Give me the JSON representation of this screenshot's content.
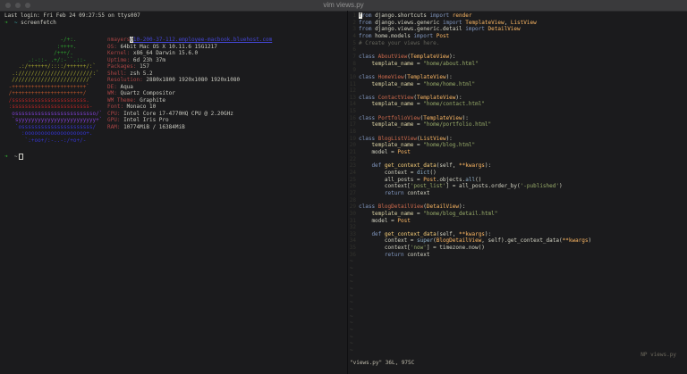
{
  "window": {
    "title": "vim views.py"
  },
  "terminal": {
    "last_login": "Last login: Fri Feb 24 09:27:55 on ttys007",
    "prompt_symbol": "➜",
    "prompt_path": "~",
    "command": "screenfetch",
    "host_line": {
      "user": "nmayers",
      "at": "@",
      "host": "10-200-37-112.employee-macbook.bluehost.com"
    },
    "ascii_art": [
      {
        "t": "                 -/+:.",
        "c": "green"
      },
      {
        "t": "                :++++.",
        "c": "green"
      },
      {
        "t": "               /+++/.",
        "c": "green"
      },
      {
        "t": "       .:-::- .+/:-``.::-",
        "c": "green"
      },
      {
        "t": "    .:/++++++/::::/++++++/:`",
        "c": "yellow"
      },
      {
        "t": "  .:///////////////////////:`",
        "c": "yellow"
      },
      {
        "t": "  ////////////////////////`",
        "c": "yellow"
      },
      {
        "t": " -+++++++++++++++++++++++`",
        "c": "orange"
      },
      {
        "t": " /++++++++++++++++++++++/",
        "c": "orange"
      },
      {
        "t": " /sssssssssssssssssssssss.",
        "c": "red"
      },
      {
        "t": " :ssssssssssssssssssssssss-",
        "c": "red"
      },
      {
        "t": "  osssssssssssssssssssssssso/`",
        "c": "purple"
      },
      {
        "t": "  `syyyyyyyyyyyyyyyyyyyyyyyy+`",
        "c": "purple"
      },
      {
        "t": "   `ossssssssssssssssssssss/",
        "c": "blue"
      },
      {
        "t": "     :ooooooooooooooooooo+.",
        "c": "blue"
      },
      {
        "t": "      `:+oo+/:-..-:/+o+/-",
        "c": "blue"
      }
    ],
    "info": [
      {
        "label": "OS:",
        "value": " 64bit Mac OS X 10.11.6 15G1217"
      },
      {
        "label": "Kernel:",
        "value": " x86_64 Darwin 15.6.0"
      },
      {
        "label": "Uptime:",
        "value": " 6d 23h 37m"
      },
      {
        "label": "Packages:",
        "value": " 157"
      },
      {
        "label": "Shell:",
        "value": " zsh 5.2"
      },
      {
        "label": "Resolution:",
        "value": " 2880x1800 1920x1080 1920x1080"
      },
      {
        "label": "DE:",
        "value": " Aqua"
      },
      {
        "label": "WM:",
        "value": " Quartz Compositor"
      },
      {
        "label": "WM Theme:",
        "value": " Graphite"
      },
      {
        "label": "Font:",
        "value": " Monaco 10"
      },
      {
        "label": "CPU:",
        "value": " Intel Core i7-4770HQ CPU @ 2.20GHz"
      },
      {
        "label": "GPU:",
        "value": " Intel Iris Pro"
      },
      {
        "label": "RAM:",
        "value": " 10774MiB / 16384MiB"
      }
    ],
    "colors": {
      "text": "#c9c9c0",
      "label": "#a84444",
      "host": "#4446d4",
      "green": "#2e9e2e",
      "yellow": "#a3a32e",
      "orange": "#b8552a",
      "red": "#b22424",
      "purple": "#7d3fd0",
      "blue": "#3434cf",
      "cyan": "#3fb3b3"
    }
  },
  "editor": {
    "statusline_right": "NP views.py",
    "statusbar": "\"views.py\" 36L, 975C",
    "empty_line_marker": "~",
    "empty_lines_count": 14,
    "colors": {
      "kw": "#8197bf",
      "typ": "#ffb964",
      "cls": "#cf6a4c",
      "fn": "#fad07a",
      "bi": "#8fb0c9",
      "str": "#99ad6a",
      "com": "#63635a",
      "txt": "#d4d4c4",
      "attr": "#ded6a6"
    },
    "lines": [
      [
        [
          "cur",
          "f"
        ],
        [
          "kw",
          "rom"
        ],
        [
          "txt",
          " django.shortcuts "
        ],
        [
          "kw",
          "import"
        ],
        [
          "typ",
          " render"
        ]
      ],
      [
        [
          "kw",
          "from"
        ],
        [
          "txt",
          " django.views.generic "
        ],
        [
          "kw",
          "import"
        ],
        [
          "typ",
          " TemplateView"
        ],
        [
          "txt",
          ","
        ],
        [
          "typ",
          " ListView"
        ]
      ],
      [
        [
          "kw",
          "from"
        ],
        [
          "txt",
          " django.views.generic.detail "
        ],
        [
          "kw",
          "import"
        ],
        [
          "typ",
          " DetailView"
        ]
      ],
      [
        [
          "kw",
          "from"
        ],
        [
          "txt",
          " home.models "
        ],
        [
          "kw",
          "import"
        ],
        [
          "typ",
          " Post"
        ]
      ],
      [
        [
          "com",
          "# Create your views here."
        ]
      ],
      [],
      [
        [
          "kw",
          "class"
        ],
        [
          "cls",
          " AboutView"
        ],
        [
          "txt",
          "("
        ],
        [
          "typ",
          "TemplateView"
        ],
        [
          "txt",
          "):"
        ]
      ],
      [
        [
          "attr",
          "    template_name"
        ],
        [
          "txt",
          " = "
        ],
        [
          "str",
          "\"home/about.html\""
        ]
      ],
      [],
      [
        [
          "kw",
          "class"
        ],
        [
          "cls",
          " HomeView"
        ],
        [
          "txt",
          "("
        ],
        [
          "typ",
          "TemplateView"
        ],
        [
          "txt",
          "):"
        ]
      ],
      [
        [
          "attr",
          "    template_name"
        ],
        [
          "txt",
          " = "
        ],
        [
          "str",
          "\"home/home.html\""
        ]
      ],
      [],
      [
        [
          "kw",
          "class"
        ],
        [
          "cls",
          " ContactView"
        ],
        [
          "txt",
          "("
        ],
        [
          "typ",
          "TemplateView"
        ],
        [
          "txt",
          "):"
        ]
      ],
      [
        [
          "attr",
          "    template_name"
        ],
        [
          "txt",
          " = "
        ],
        [
          "str",
          "\"home/contact.html\""
        ]
      ],
      [],
      [
        [
          "kw",
          "class"
        ],
        [
          "cls",
          " PortfolioView"
        ],
        [
          "txt",
          "("
        ],
        [
          "typ",
          "TemplateView"
        ],
        [
          "txt",
          "):"
        ]
      ],
      [
        [
          "attr",
          "    template_name"
        ],
        [
          "txt",
          " = "
        ],
        [
          "str",
          "\"home/portfolio.html\""
        ]
      ],
      [],
      [
        [
          "kw",
          "class"
        ],
        [
          "cls",
          " BlogListView"
        ],
        [
          "txt",
          "("
        ],
        [
          "typ",
          "ListView"
        ],
        [
          "txt",
          "):"
        ]
      ],
      [
        [
          "attr",
          "    template_name"
        ],
        [
          "txt",
          " = "
        ],
        [
          "str",
          "\"home/blog.html\""
        ]
      ],
      [
        [
          "txt",
          "    model = "
        ],
        [
          "typ",
          "Post"
        ]
      ],
      [],
      [
        [
          "kw",
          "    def"
        ],
        [
          "fn",
          " get_context_data"
        ],
        [
          "txt",
          "(self, "
        ],
        [
          "typ",
          "**kwargs"
        ],
        [
          "txt",
          "):"
        ]
      ],
      [
        [
          "txt",
          "        context = "
        ],
        [
          "bi",
          "dict"
        ],
        [
          "txt",
          "()"
        ]
      ],
      [
        [
          "txt",
          "        all_posts = "
        ],
        [
          "typ",
          "Post"
        ],
        [
          "txt",
          ".objects."
        ],
        [
          "bi",
          "all"
        ],
        [
          "txt",
          "()"
        ]
      ],
      [
        [
          "txt",
          "        context["
        ],
        [
          "str",
          "'post_list'"
        ],
        [
          "txt",
          "] = all_posts.order_by("
        ],
        [
          "str",
          "'-published'"
        ],
        [
          "txt",
          ")"
        ]
      ],
      [
        [
          "kw",
          "        return"
        ],
        [
          "txt",
          " context"
        ]
      ],
      [],
      [
        [
          "kw",
          "class"
        ],
        [
          "cls",
          " BlogDetailView"
        ],
        [
          "txt",
          "("
        ],
        [
          "typ",
          "DetailView"
        ],
        [
          "txt",
          "):"
        ]
      ],
      [
        [
          "attr",
          "    template_name"
        ],
        [
          "txt",
          " = "
        ],
        [
          "str",
          "\"home/blog_detail.html\""
        ]
      ],
      [
        [
          "txt",
          "    model = "
        ],
        [
          "typ",
          "Post"
        ]
      ],
      [],
      [
        [
          "kw",
          "    def"
        ],
        [
          "fn",
          " get_context_data"
        ],
        [
          "txt",
          "(self, "
        ],
        [
          "typ",
          "**kwargs"
        ],
        [
          "txt",
          "):"
        ]
      ],
      [
        [
          "txt",
          "        context = "
        ],
        [
          "bi",
          "super"
        ],
        [
          "txt",
          "("
        ],
        [
          "typ",
          "BlogDetailView"
        ],
        [
          "txt",
          ", self).get_context_data("
        ],
        [
          "typ",
          "**kwargs"
        ],
        [
          "txt",
          ")"
        ]
      ],
      [
        [
          "txt",
          "        context["
        ],
        [
          "str",
          "'now'"
        ],
        [
          "txt",
          "] = timezone.now()"
        ]
      ],
      [
        [
          "kw",
          "        return"
        ],
        [
          "txt",
          " context"
        ]
      ]
    ]
  }
}
